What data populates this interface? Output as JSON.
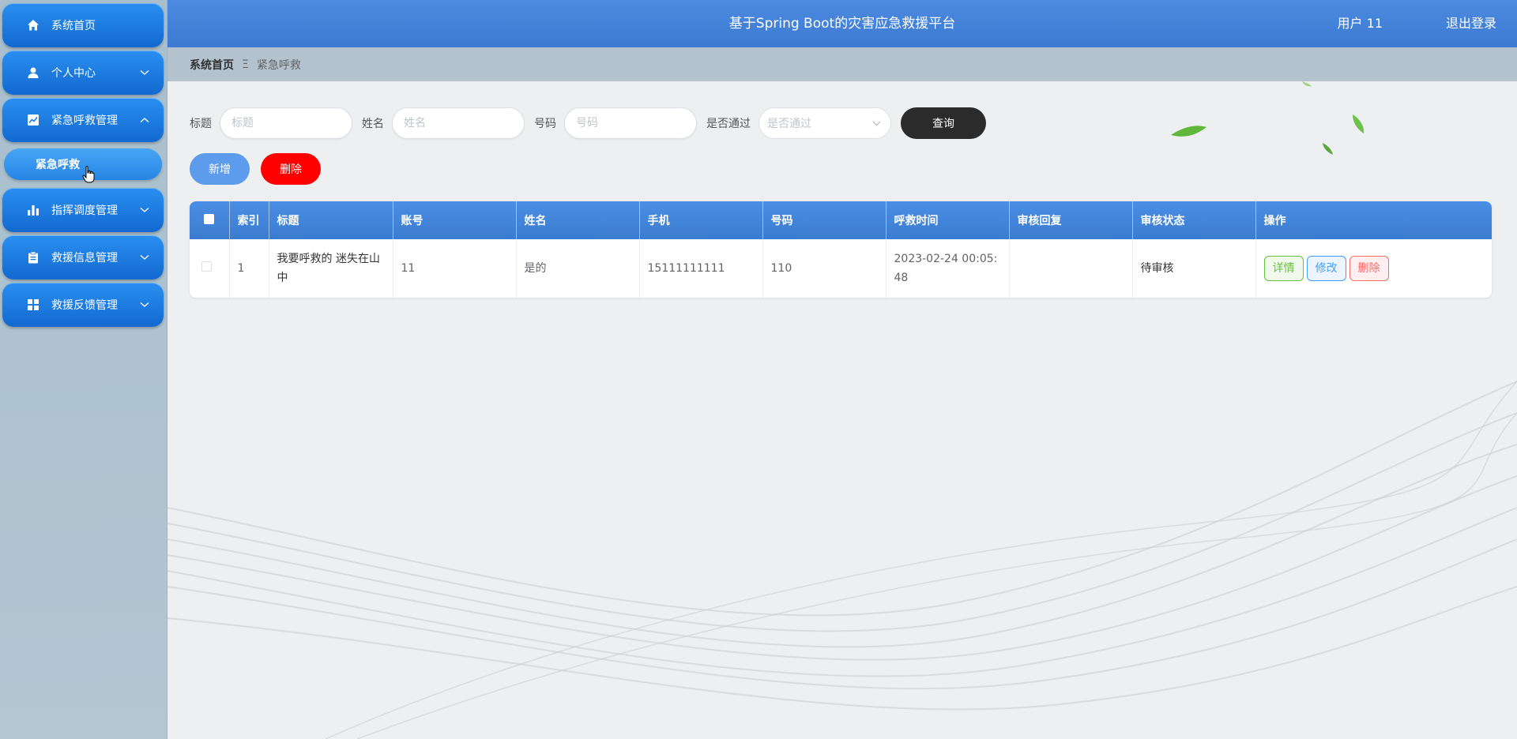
{
  "header": {
    "title": "基于Spring Boot的灾害应急救援平台",
    "user": "用户 11",
    "logout": "退出登录"
  },
  "sidebar": {
    "items": [
      {
        "label": "系统首页",
        "icon": "home-icon"
      },
      {
        "label": "个人中心",
        "icon": "user-icon",
        "chevron": "down"
      },
      {
        "label": "紧急呼救管理",
        "icon": "chart-line-icon",
        "chevron": "up"
      },
      {
        "label": "指挥调度管理",
        "icon": "bar-chart-icon",
        "chevron": "down"
      },
      {
        "label": "救援信息管理",
        "icon": "clipboard-icon",
        "chevron": "down"
      },
      {
        "label": "救援反馈管理",
        "icon": "grid-icon",
        "chevron": "down"
      }
    ],
    "submenu": {
      "label": "紧急呼救"
    }
  },
  "breadcrumb": {
    "home": "系统首页",
    "separator": "Ξ",
    "current": "紧急呼救"
  },
  "search": {
    "title_label": "标题",
    "title_placeholder": "标题",
    "name_label": "姓名",
    "name_placeholder": "姓名",
    "number_label": "号码",
    "number_placeholder": "号码",
    "pass_label": "是否通过",
    "pass_placeholder": "是否通过",
    "query_button": "查询"
  },
  "actions": {
    "add": "新增",
    "delete": "删除"
  },
  "table": {
    "headers": [
      "索引",
      "标题",
      "账号",
      "姓名",
      "手机",
      "号码",
      "呼救时间",
      "审核回复",
      "审核状态",
      "操作"
    ],
    "rows": [
      {
        "index": "1",
        "title": "我要呼救的 迷失在山中",
        "account": "11",
        "name": "是的",
        "phone": "15111111111",
        "number": "110",
        "time": "2023-02-24 00:05:48",
        "reply": "",
        "status": "待审核",
        "ops": {
          "detail": "详情",
          "edit": "修改",
          "remove": "删除"
        }
      }
    ]
  },
  "colors": {
    "primary": "#3b7ccf",
    "sidebar_item": "#1a78dc",
    "query": "#2b2b2b",
    "delete": "#ff0000",
    "add": "#5d9cec"
  }
}
